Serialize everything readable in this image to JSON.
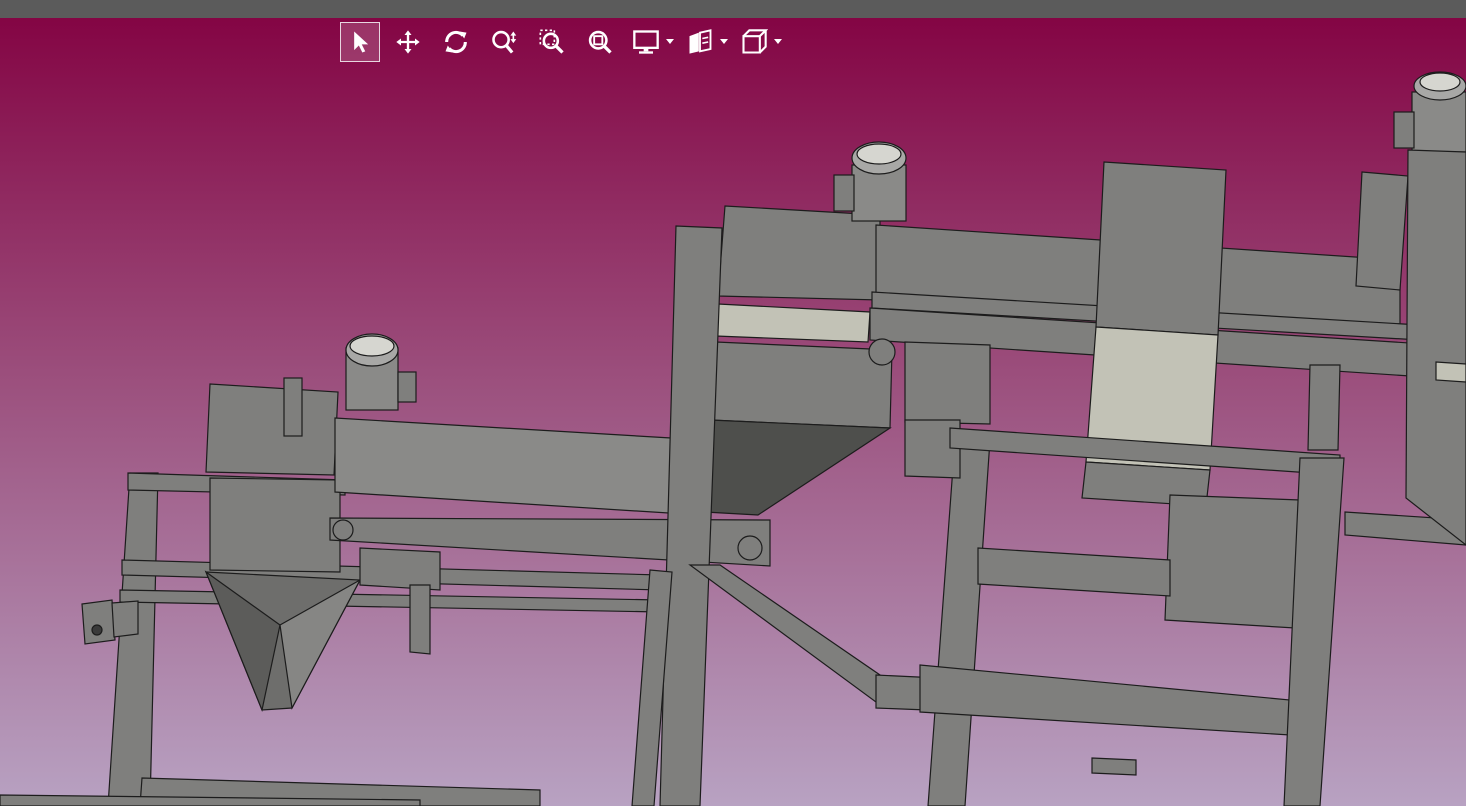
{
  "window": {
    "title": "",
    "background_top": "#840544",
    "background_bottom": "#b8a2c2",
    "titlebar_color": "#5b5b5b"
  },
  "toolbar": {
    "tools": [
      {
        "id": "select",
        "icon": "cursor-arrow-icon",
        "active": true
      },
      {
        "id": "pan",
        "icon": "move-arrows-icon",
        "active": false
      },
      {
        "id": "rotate",
        "icon": "rotate-icon",
        "active": false
      },
      {
        "id": "zoom",
        "icon": "zoom-updown-icon",
        "active": false
      },
      {
        "id": "zoom-window",
        "icon": "zoom-window-icon",
        "active": false
      },
      {
        "id": "zoom-fit",
        "icon": "zoom-fit-icon",
        "active": false
      },
      {
        "id": "display-mode",
        "icon": "monitor-icon",
        "dropdown": true
      },
      {
        "id": "section-view",
        "icon": "section-view-icon",
        "dropdown": true
      },
      {
        "id": "view-orientation",
        "icon": "cube-view-icon",
        "dropdown": true
      }
    ],
    "icon_color": "#ffffff"
  },
  "model": {
    "part_fill": "#7f7f7d",
    "part_stroke": "#1c1c1c",
    "highlight_fill": "#c2c2b6",
    "shadow_fill": "#4e4f4c"
  }
}
